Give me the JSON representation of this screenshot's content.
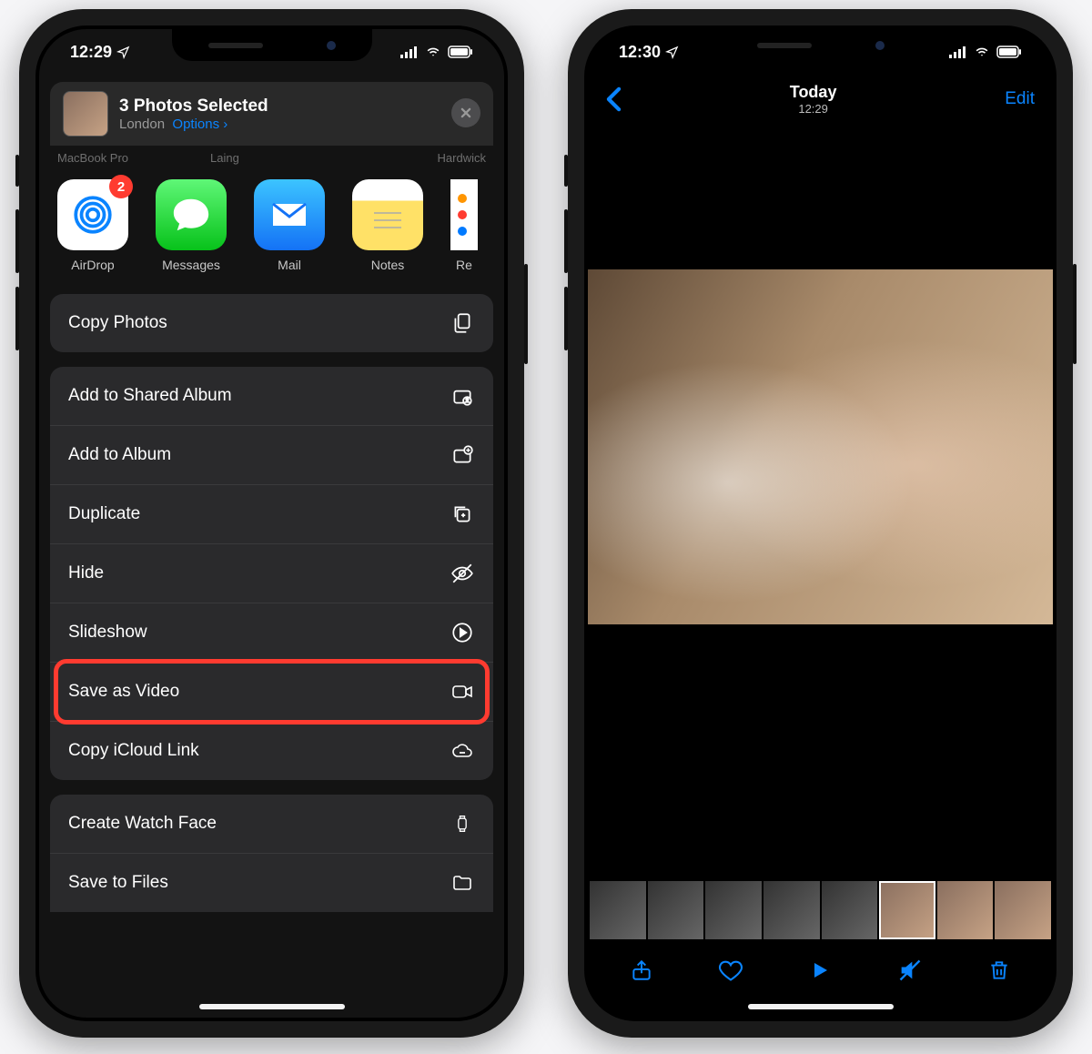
{
  "left": {
    "status_time": "12:29",
    "share_header": {
      "title": "3 Photos Selected",
      "location": "London",
      "options_label": "Options",
      "chevron": "›"
    },
    "airdrop_targets": [
      "MacBook Pro",
      "Laing",
      "Hardwick"
    ],
    "apps": [
      {
        "label": "AirDrop",
        "badge": "2"
      },
      {
        "label": "Messages"
      },
      {
        "label": "Mail"
      },
      {
        "label": "Notes"
      },
      {
        "label": "Re"
      }
    ],
    "actions_group1": [
      {
        "label": "Copy Photos",
        "icon": "copy"
      }
    ],
    "actions_group2": [
      {
        "label": "Add to Shared Album",
        "icon": "shared-album"
      },
      {
        "label": "Add to Album",
        "icon": "add-album"
      },
      {
        "label": "Duplicate",
        "icon": "duplicate"
      },
      {
        "label": "Hide",
        "icon": "hide"
      },
      {
        "label": "Slideshow",
        "icon": "play-circle"
      },
      {
        "label": "Save as Video",
        "icon": "video",
        "highlighted": true
      },
      {
        "label": "Copy iCloud Link",
        "icon": "cloud-link"
      }
    ],
    "actions_group3": [
      {
        "label": "Create Watch Face",
        "icon": "watch"
      },
      {
        "label": "Save to Files",
        "icon": "folder"
      }
    ]
  },
  "right": {
    "status_time": "12:30",
    "nav": {
      "title": "Today",
      "subtitle": "12:29",
      "edit_label": "Edit"
    },
    "thumbs_count": 8,
    "toolbar": [
      "share",
      "favorite",
      "play",
      "mute",
      "trash"
    ]
  }
}
